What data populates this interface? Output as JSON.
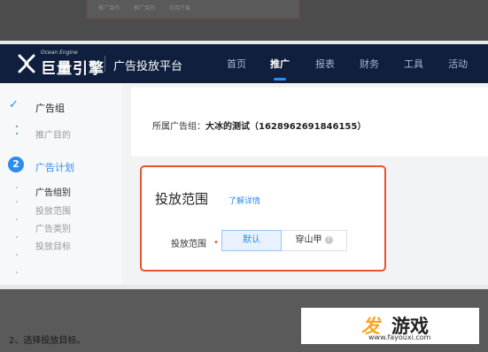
{
  "top_fragment": {
    "items": [
      "推广目的",
      "推广目的",
      "应用下载"
    ]
  },
  "navbar": {
    "logo_en": "Ocean Engine",
    "logo_cn": "巨量引擎",
    "platform": "广告投放平台",
    "items": [
      "首页",
      "推广",
      "报表",
      "财务",
      "工具",
      "活动"
    ],
    "active": "推广"
  },
  "sidebar": {
    "step1_title": "广告组",
    "step1_sub": "推广目的",
    "step2_number": "2",
    "step2_title": "广告计划",
    "step2_items": [
      "广告组别",
      "投放范围",
      "广告类别",
      "投放目标"
    ]
  },
  "main": {
    "group_label": "所属广告组：",
    "group_value": "大冰的测试（1628962691846155）",
    "section_title": "投放范围",
    "detail_link": "了解详情",
    "field_label": "投放范围",
    "required_mark": "•",
    "options": [
      "默认",
      "穿山甲"
    ],
    "selected": "默认",
    "help_glyph": "?"
  },
  "caption": "2、选择投放目标。",
  "watermark": {
    "brand_a": "发",
    "brand_b": "游戏",
    "url": "www.fayouxi.com"
  },
  "colors": {
    "accent": "#2d8cf0",
    "highlight_border": "#e8542e",
    "nav_bg": "#0f1f3d"
  }
}
